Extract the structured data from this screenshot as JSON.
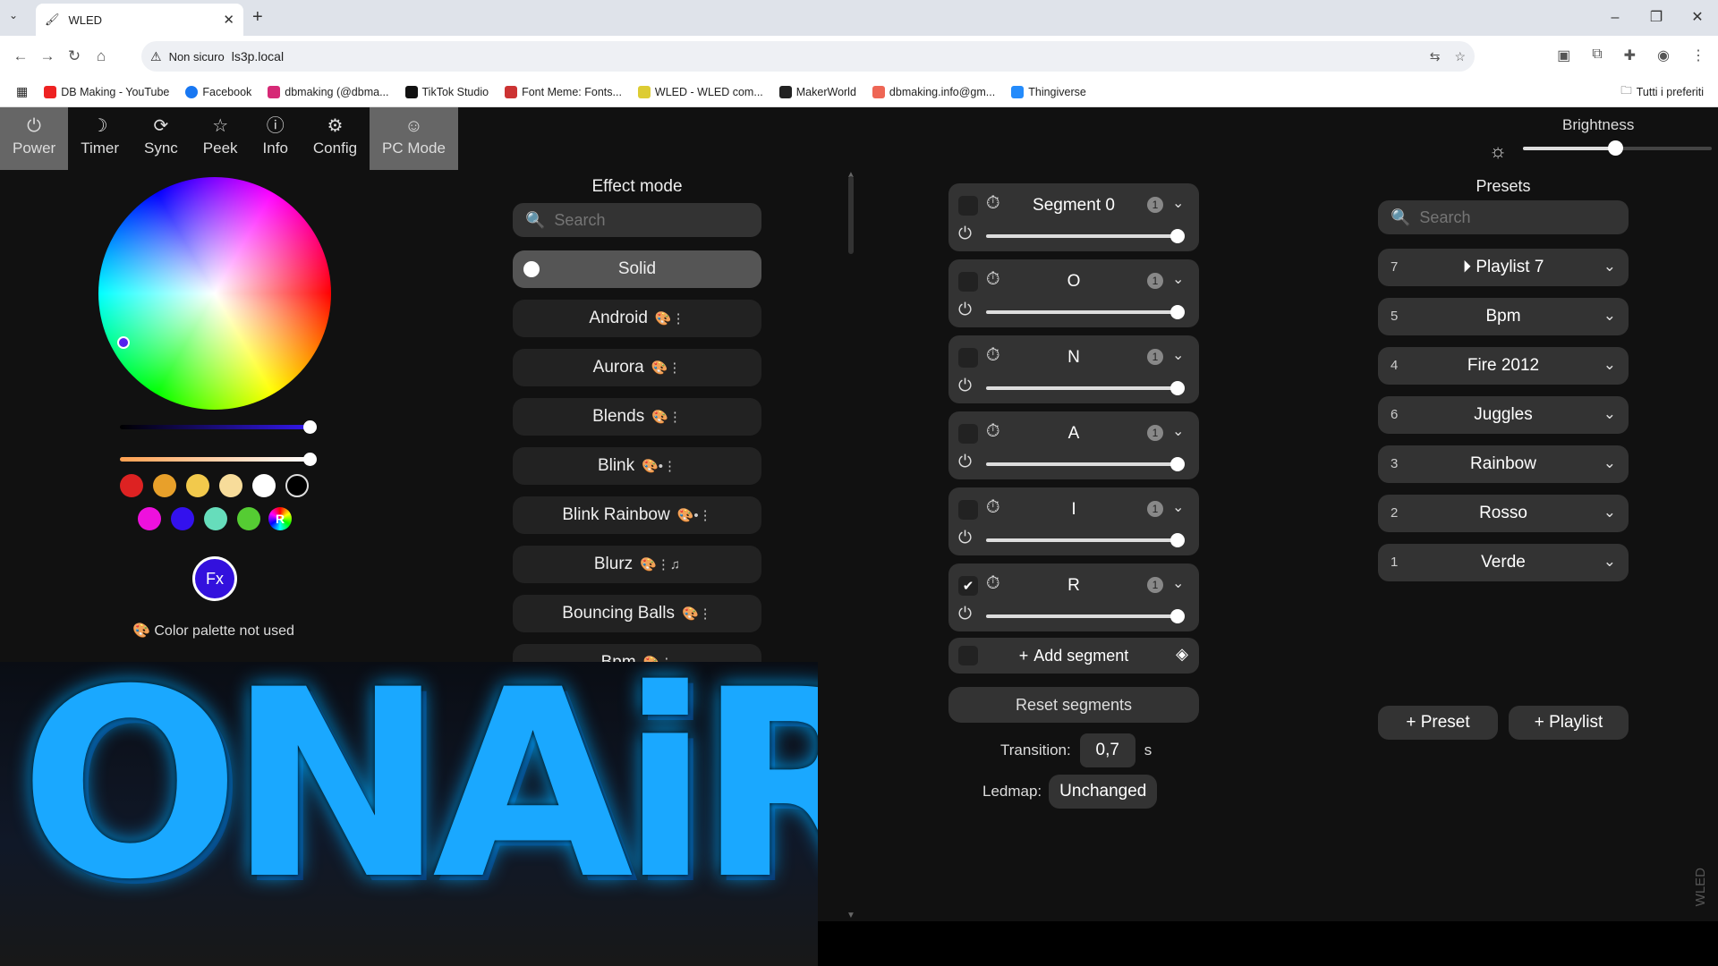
{
  "browser": {
    "tab_title": "WLED",
    "security_label": "Non sicuro",
    "url": "ls3p.local",
    "bookmarks": [
      "DB Making - YouTube",
      "Facebook",
      "dbmaking (@dbma...",
      "TikTok Studio",
      "Font Meme: Fonts...",
      "WLED - WLED com...",
      "MakerWorld",
      "dbmaking.info@gm...",
      "Thingiverse"
    ],
    "all_bookmarks": "Tutti i preferiti"
  },
  "nav": {
    "items": [
      {
        "label": "Power",
        "icon": "power-icon"
      },
      {
        "label": "Timer",
        "icon": "moon-icon"
      },
      {
        "label": "Sync",
        "icon": "sync-icon"
      },
      {
        "label": "Peek",
        "icon": "star-icon"
      },
      {
        "label": "Info",
        "icon": "info-icon"
      },
      {
        "label": "Config",
        "icon": "gear-icon"
      },
      {
        "label": "PC Mode",
        "icon": "smiley-icon"
      }
    ]
  },
  "brightness": {
    "label": "Brightness",
    "value": 0.49
  },
  "colors": {
    "primary": "#3311dd",
    "swatches": [
      "#dd2222",
      "#e8a02a",
      "#f2c94c",
      "#f7dc9a",
      "#ffffff",
      "#000000",
      "#ee11dd",
      "#3311ee",
      "#66ddbb",
      "#55cc33",
      "#ee8800"
    ],
    "random_label": "R",
    "fx_label": "Fx",
    "palette_note": "Color palette not used"
  },
  "effects": {
    "title": "Effect mode",
    "search_placeholder": "Search",
    "items": [
      {
        "name": "Solid",
        "flags": ""
      },
      {
        "name": "Android",
        "flags": "🎨⋮"
      },
      {
        "name": "Aurora",
        "flags": "🎨⋮"
      },
      {
        "name": "Blends",
        "flags": "🎨⋮"
      },
      {
        "name": "Blink",
        "flags": "🎨•⋮"
      },
      {
        "name": "Blink Rainbow",
        "flags": "🎨•⋮"
      },
      {
        "name": "Blurz",
        "flags": "🎨⋮♫"
      },
      {
        "name": "Bouncing Balls",
        "flags": "🎨⋮"
      },
      {
        "name": "Bpm",
        "flags": "🎨⋮"
      }
    ]
  },
  "segments": {
    "items": [
      {
        "name": "Segment 0",
        "checked": false,
        "badge": "1",
        "level": 1.0
      },
      {
        "name": "O",
        "checked": false,
        "badge": "1",
        "level": 1.0
      },
      {
        "name": "N",
        "checked": false,
        "badge": "1",
        "level": 1.0
      },
      {
        "name": "A",
        "checked": false,
        "badge": "1",
        "level": 1.0
      },
      {
        "name": "I",
        "checked": false,
        "badge": "1",
        "level": 1.0
      },
      {
        "name": "R",
        "checked": true,
        "badge": "1",
        "level": 1.0
      }
    ],
    "add_label": "Add segment",
    "reset_label": "Reset segments",
    "transition_label": "Transition:",
    "transition_value": "0,7",
    "transition_unit": "s",
    "ledmap_label": "Ledmap:",
    "ledmap_value": "Unchanged"
  },
  "presets": {
    "title": "Presets",
    "search_placeholder": "Search",
    "items": [
      {
        "id": "7",
        "name": "Playlist 7",
        "playlist": true
      },
      {
        "id": "5",
        "name": "Bpm"
      },
      {
        "id": "4",
        "name": "Fire 2012"
      },
      {
        "id": "6",
        "name": "Juggles"
      },
      {
        "id": "3",
        "name": "Rainbow"
      },
      {
        "id": "2",
        "name": "Rosso"
      },
      {
        "id": "1",
        "name": "Verde"
      }
    ],
    "add_preset": "Preset",
    "add_playlist": "Playlist"
  },
  "overlay_text": "ONAiR",
  "footer": "WLED"
}
